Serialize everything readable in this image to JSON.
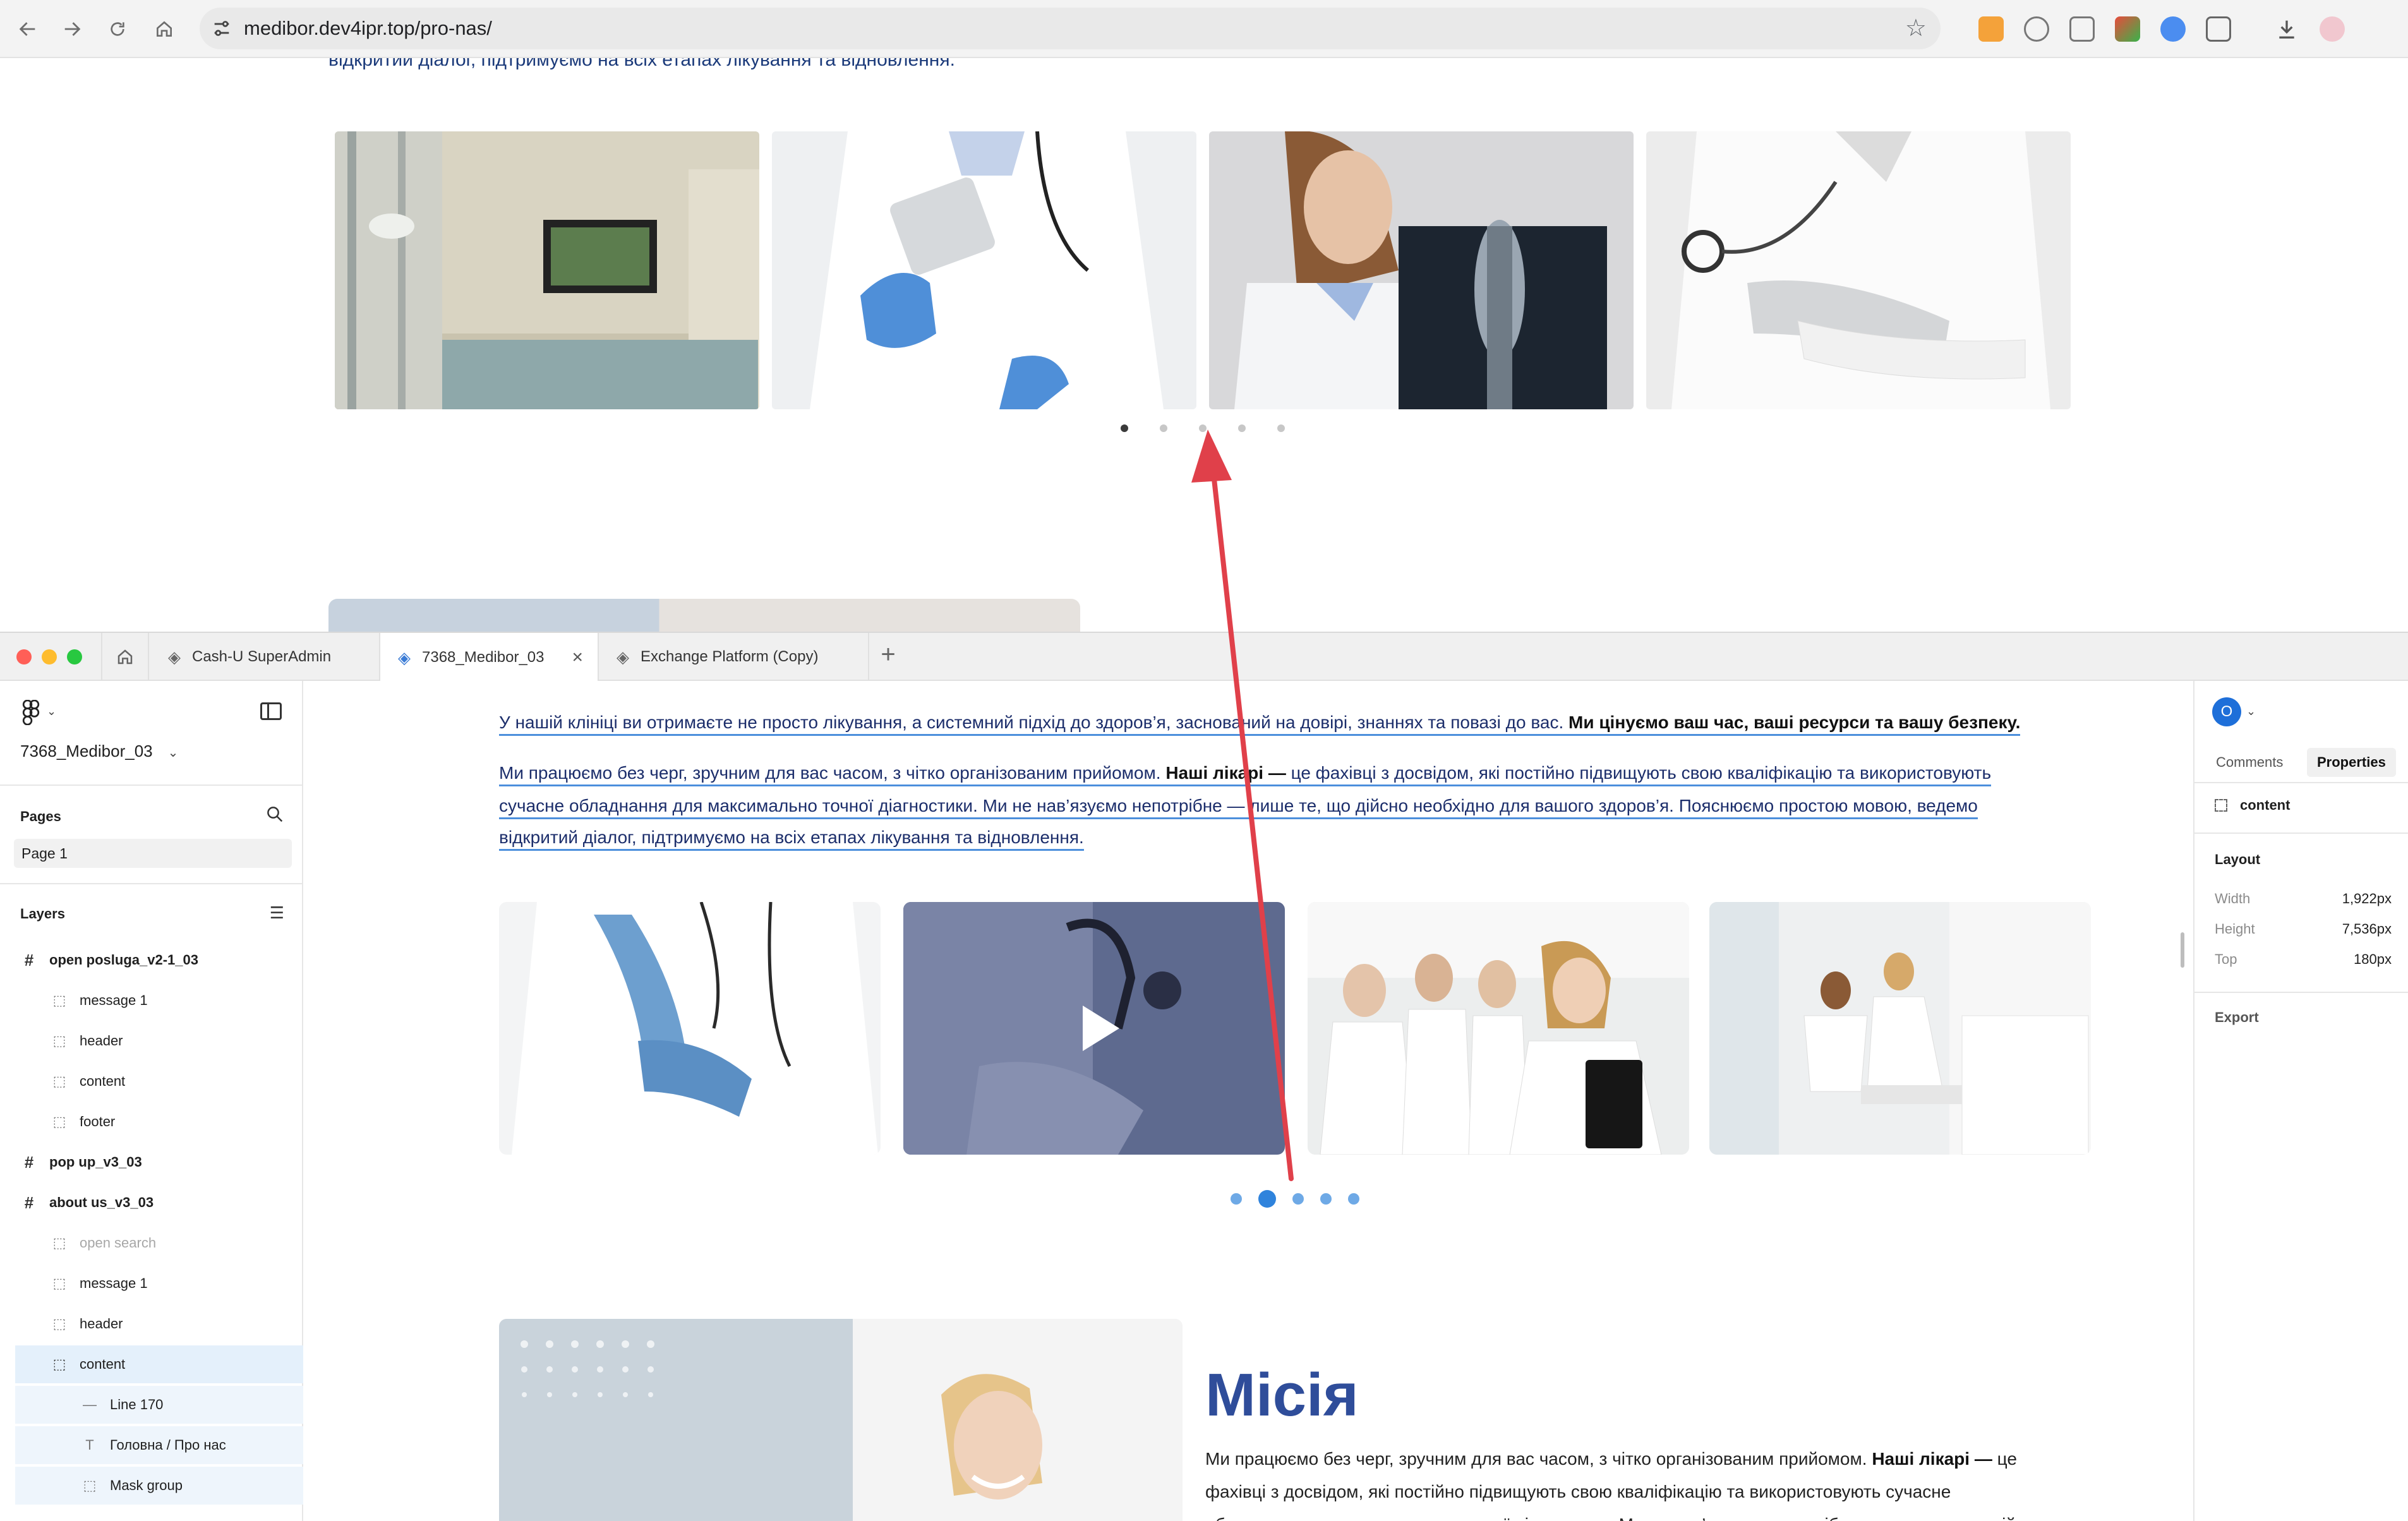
{
  "browser": {
    "url_host": "medibor.dev4ipr.top",
    "url_path": "/pro-nas/"
  },
  "site": {
    "top_text": "відкритий діалог, підтримуємо на всіх етапах лікування та відновлення.",
    "carousel": {
      "photos": [
        "clinic-waiting-room",
        "nurse-with-pills",
        "doctor-with-xray",
        "doctor-with-stethoscope"
      ],
      "dots": 5,
      "active_dot": 1
    }
  },
  "figma": {
    "tabs": [
      {
        "label": "Cash-U SuperAdmin"
      },
      {
        "label": "7368_Medibor_03"
      },
      {
        "label": "Exchange Platform (Copy)"
      }
    ],
    "file_name": "7368_Medibor_03",
    "pages_title": "Pages",
    "page_1": "Page 1",
    "layers_title": "Layers",
    "layers": [
      {
        "label": "open posluga_v2-1_03",
        "type": "frame",
        "indent": 0
      },
      {
        "label": "message 1",
        "type": "section",
        "indent": 1
      },
      {
        "label": "header",
        "type": "section",
        "indent": 1
      },
      {
        "label": "content",
        "type": "section",
        "indent": 1
      },
      {
        "label": "footer",
        "type": "section",
        "indent": 1
      },
      {
        "label": "pop up_v3_03",
        "type": "frame",
        "indent": 0
      },
      {
        "label": "about us_v3_03",
        "type": "frame",
        "indent": 0
      },
      {
        "label": "open search",
        "type": "section",
        "indent": 1,
        "dim": true
      },
      {
        "label": "message 1",
        "type": "section",
        "indent": 1
      },
      {
        "label": "header",
        "type": "section",
        "indent": 1
      },
      {
        "label": "content",
        "type": "section",
        "indent": 1,
        "selected": true
      },
      {
        "label": "Line 170",
        "type": "line",
        "indent": 2
      },
      {
        "label": "Головна / Про нас",
        "type": "text",
        "indent": 2
      },
      {
        "label": "Mask group",
        "type": "section",
        "indent": 2
      }
    ],
    "canvas": {
      "para1_normal": "У нашій клініці ви отримаєте не просто лікування, а системний підхід до здоров’я, заснований на довірі, знаннях та повазі до вас. ",
      "para1_bold": "Ми цінуємо ваш час, ваші ресурси та вашу безпеку.",
      "para2_line1_a": "Ми працюємо без черг, зручним для вас часом, з чітко організованим прийомом. ",
      "para2_line1_bold": "Наші лікарі —",
      "para2_line1_b": " це фахівці з досвідом, які постійно підвищують свою кваліфікацію та використовують",
      "para2_line2": "сучасне обладнання для максимально точної діагностики. Ми не нав’язуємо непотрібне — лише те, що дійсно необхідно для вашого здоров’я. Пояснюємо простою мовою, ведемо",
      "para2_line3": "відкритий діалог, підтримуємо на всіх етапах лікування та відновлення.",
      "carousel_dots": 5,
      "carousel_active": 2,
      "mission_title": "Місія",
      "mission_line1_a": "Ми працюємо без черг, зручним для вас часом, з чітко організованим прийомом. ",
      "mission_line1_bold": "Наші лікарі —",
      "mission_line1_b": " це",
      "mission_line2": "фахівці з досвідом, які постійно підвищують свою кваліфікацію та використовують сучасне",
      "mission_line3": "обладнання для максимально точної діагностики. Ми не нав’язуємо непотрібне — лише те, що дійсно"
    },
    "right_panel": {
      "avatar_letter": "O",
      "tab_comments": "Comments",
      "tab_properties": "Properties",
      "selection": "content",
      "layout_title": "Layout",
      "width_label": "Width",
      "width_value": "1,922px",
      "height_label": "Height",
      "height_value": "7,536px",
      "top_label": "Top",
      "top_value": "180px",
      "export_title": "Export"
    }
  },
  "colors": {
    "annotation_arrow": "#e0404a",
    "mission_title": "#2f4d9a",
    "selection_blue": "#4c8fdc",
    "dot_active": "#2f83dc"
  }
}
